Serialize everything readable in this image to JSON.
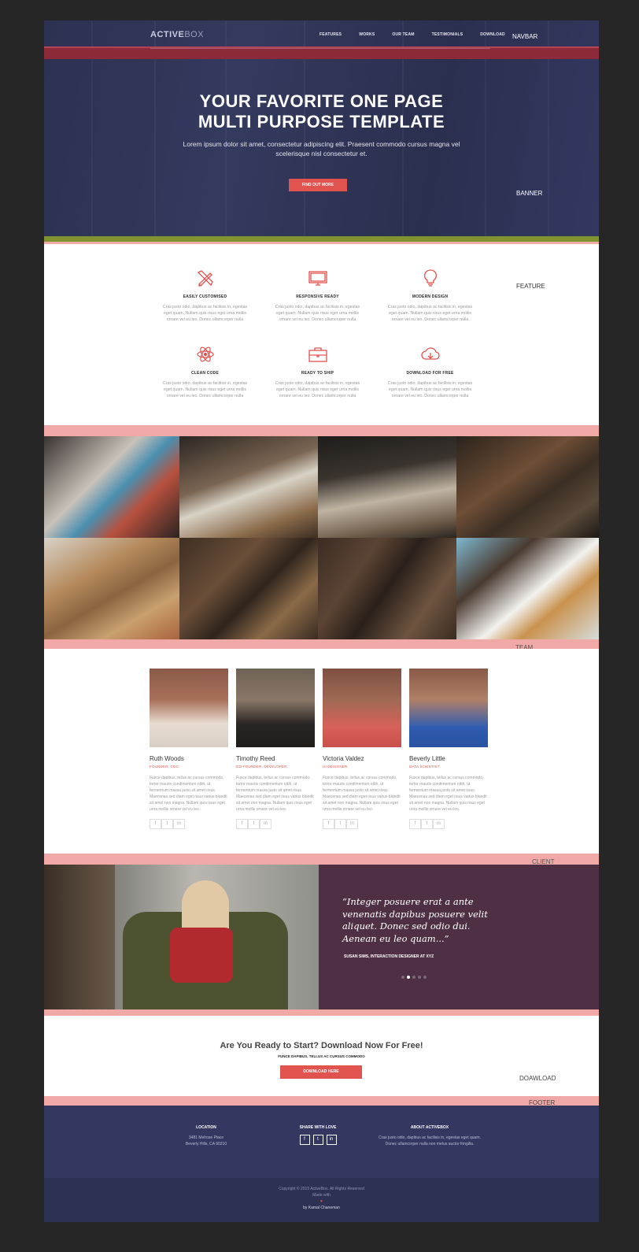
{
  "navbar": {
    "logo_bold": "ACTIVE",
    "logo_light": "BOX",
    "items": [
      "FEATURES",
      "WORKS",
      "OUR TEAM",
      "TESTIMONIALS",
      "DOWNLOAD"
    ],
    "section_label": "NAVBAR"
  },
  "hero": {
    "title_line1": "YOUR FAVORITE ONE PAGE",
    "title_line2": "MULTI PURPOSE TEMPLATE",
    "subtitle": "Lorem ipsum dolor sit amet, consectetur adipiscing elit. Praesent commodo cursus magna vel scelerisque nisl consectetur et.",
    "button": "FIND OUT MORE",
    "section_label": "BANNER"
  },
  "features": {
    "section_label": "FEATURE",
    "items": [
      {
        "icon": "pencil-ruler-icon",
        "title": "EASILY CUSTOMISED",
        "text": "Cras justo odio, dapibus ac facilisis in, egestas eget quam. Nullam quis risus eget urna mollis ornare vel eu leo. Donec ullamcorper nulla"
      },
      {
        "icon": "monitor-icon",
        "title": "RESPONSIVE READY",
        "text": "Cras justo odio, dapibus ac facilisis in, egestas eget quam. Nullam quis risus eget urna mollis ornare vel eu leo. Donec ullamcorper nulla"
      },
      {
        "icon": "lightbulb-icon",
        "title": "MODERN DESIGN",
        "text": "Cras justo odio, dapibus ac facilisis in, egestas eget quam. Nullam quis risus eget urna mollis ornare vel eu leo. Donec ullamcorper nulla"
      },
      {
        "icon": "atom-icon",
        "title": "CLEAN CODE",
        "text": "Cras justo odio, dapibus ac facilisis in, egestas eget quam. Nullam quis risus eget urna mollis ornare vel eu leo. Donec ullamcorper nulla"
      },
      {
        "icon": "briefcase-icon",
        "title": "READY TO SHIP",
        "text": "Cras justo odio, dapibus ac facilisis in, egestas eget quam. Nullam quis risus eget urna mollis ornare vel eu leo. Donec ullamcorper nulla"
      },
      {
        "icon": "cloud-download-icon",
        "title": "DOWNLOAD FOR FREE",
        "text": "Cras justo odio, dapibus ac facilisis in, egestas eget quam. Nullam quis risus eget urna mollis ornare vel eu leo. Donec ullamcorper nulla"
      }
    ]
  },
  "gallery": {
    "section_label": "TEAM"
  },
  "team": {
    "members": [
      {
        "name": "Ruth Woods",
        "role": "FOUNDER, CEO",
        "bio": "Fusce dapibus, tellus ac cursus commodo, tortor mauris condimentum nibh, ut fermentum massa justo sit amet risus. Maecenas sed diam eget risus varius blandit sit amet non magna. Nullam quis risus eget urna mollis ornare vel eu leo."
      },
      {
        "name": "Timothy Reed",
        "role": "CO-FOUNDER, DEVELOPER",
        "bio": "Fusce dapibus, tellus ac cursus commodo, tortor mauris condimentum nibh, ut fermentum massa justo sit amet risus. Maecenas sed diam eget risus varius blandit sit amet non magna. Nullam quis risus eget urna mollis ornare vel eu leo."
      },
      {
        "name": "Victoria Valdez",
        "role": "UI DESIGNER",
        "bio": "Fusce dapibus, tellus ac cursus commodo, tortor mauris condimentum nibh, ut fermentum massa justo sit amet risus. Maecenas sed diam eget risus varius blandit sit amet non magna. Nullam quis risus eget urna mollis ornare vel eu leo."
      },
      {
        "name": "Beverly Little",
        "role": "DATA SCIENTIST",
        "bio": "Fusce dapibus, tellus ac cursus commodo, tortor mauris condimentum nibh, ut fermentum massa justo sit amet risus. Maecenas sed diam eget risus varius blandit sit amet non magna. Nullam quis risus eget urna mollis ornare vel eu leo."
      }
    ],
    "section_label": "CLIENT"
  },
  "testimonial": {
    "quote": "“Integer posuere erat a ante venenatis dapibus posuere velit aliquet. Donec sed odio dui. Aenean eu leo quam...”",
    "author": "SUSAN SIMS, INTERACTION DESIGNER AT XYZ"
  },
  "download": {
    "title": "Are You Ready to Start? Download Now For Free!",
    "subtitle": "FUNCE DAPIBUS, TELLUS AC CURSUS COMMODO",
    "button": "DOWNLOAD HERE",
    "section_label": "DOAWLOAD"
  },
  "footer": {
    "section_label": "FOOTER",
    "location_title": "LOCATION",
    "location_line1": "3481 Melrose Place",
    "location_line2": "Beverly Hills, CA 90210",
    "share_title": "SHARE WITH LOVE",
    "about_title": "ABOUT ACTIVEBOX",
    "about_text": "Cras justo odio, dapibus ac facilisis in, egestas eget quam. Donec ullamcorper nulla non metus auctor fringilla.",
    "copyright": "Copyright © 2015 ActiveBox. All Rights Reserved",
    "made_with": "Made with",
    "heart": "♥",
    "author": "by Kamal Chaneman"
  },
  "colors": {
    "navy": "#343861",
    "accent_red": "#e0534f",
    "pink_band": "#f0a9a6",
    "green_strip": "#7f9431",
    "plum": "#4e2f44"
  }
}
